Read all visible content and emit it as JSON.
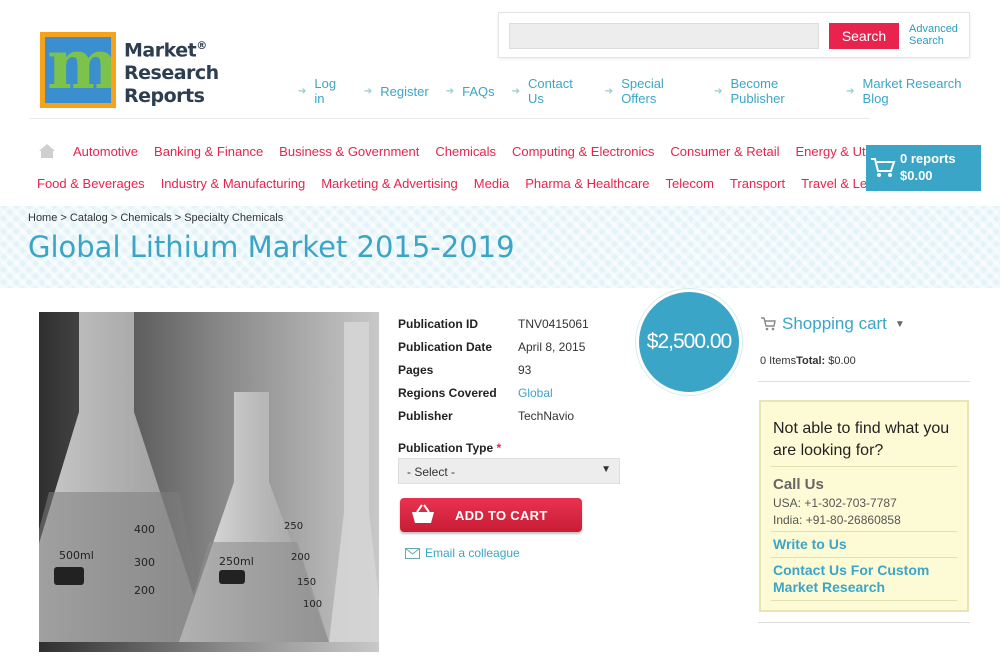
{
  "logo": {
    "line1": "Market",
    "line2": "Research",
    "line3": "Reports",
    "reg": "®",
    "letter": "m"
  },
  "search": {
    "placeholder": "",
    "button": "Search",
    "advanced_line1": "Advanced",
    "advanced_line2": "Search"
  },
  "top_links": [
    "Log in",
    "Register",
    "FAQs",
    "Contact Us",
    "Special Offers",
    "Become Publisher",
    "Market Research Blog"
  ],
  "categories_row1": [
    "Automotive",
    "Banking & Finance",
    "Business & Government",
    "Chemicals",
    "Computing & Electronics",
    "Consumer & Retail",
    "Energy & Utilities"
  ],
  "categories_row2": [
    "Food & Beverages",
    "Industry & Manufacturing",
    "Marketing & Advertising",
    "Media",
    "Pharma & Healthcare",
    "Telecom",
    "Transport",
    "Travel & Leisure"
  ],
  "header_cart": {
    "reports": "0 reports",
    "amount": "$0.00"
  },
  "breadcrumb": "Home > Catalog > Chemicals > Specialty Chemicals",
  "page_title": "Global Lithium Market 2015-2019",
  "product": {
    "rows": [
      {
        "label": "Publication ID",
        "value": "TNV0415061"
      },
      {
        "label": "Publication Date",
        "value": "April 8, 2015"
      },
      {
        "label": "Pages",
        "value": "93"
      },
      {
        "label": "Regions Covered",
        "value": "Global"
      },
      {
        "label": "Publisher",
        "value": "TechNavio"
      }
    ],
    "pub_type_label": "Publication Type",
    "required_mark": "*",
    "select_value": "- Select -",
    "add_to_cart": "ADD TO CART",
    "email": "Email a colleague",
    "price": "$2,500.00",
    "image_labels": {
      "flask1": "500ml",
      "flask1_ticks": [
        "400",
        "300",
        "200"
      ],
      "flask2": "250ml",
      "flask2_ticks": [
        "250",
        "200",
        "150",
        "100"
      ]
    }
  },
  "sidebar": {
    "cart_title": "Shopping cart",
    "items_text": "0 Items",
    "total_label": "Total:",
    "total_value": "$0.00",
    "help_title": "Not able to find what you are looking for?",
    "call_us": "Call Us",
    "usa": "USA: +1-302-703-7787",
    "india": "India: +91-80-26860858",
    "write_to_us": "Write to Us",
    "custom": "Contact Us For Custom Market Research"
  },
  "colors": {
    "accent": "#3ba5c7",
    "brand_red": "#e8234d",
    "help_bg": "#fdfbd6"
  }
}
